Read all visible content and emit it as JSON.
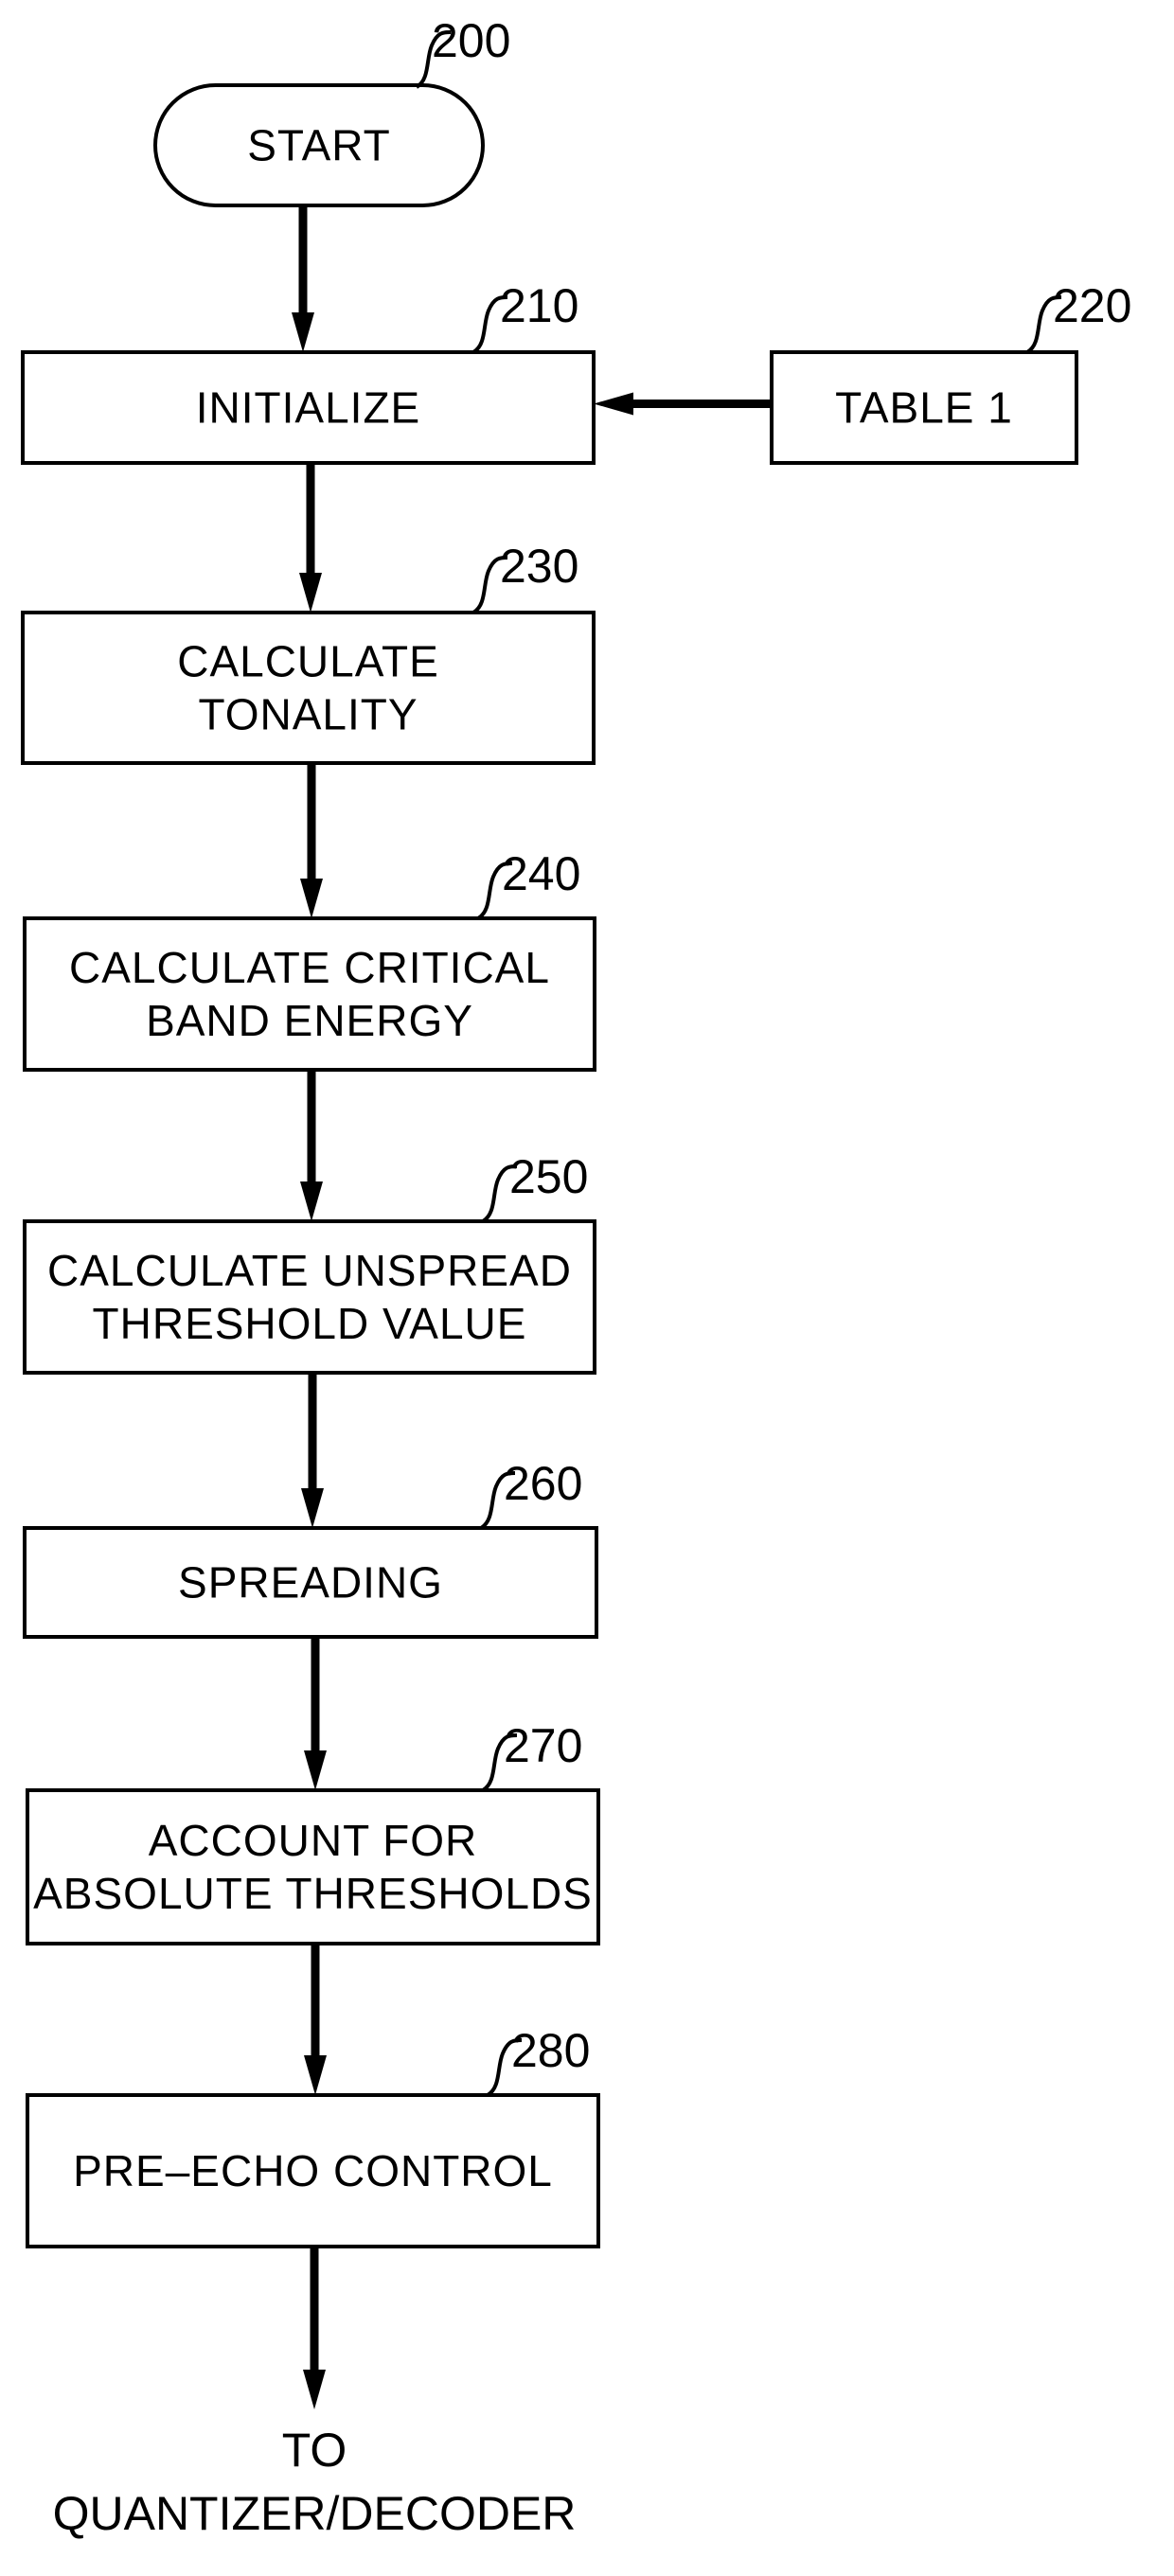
{
  "diagram": {
    "type": "flowchart",
    "nodes": [
      {
        "id": "200",
        "ref": "200",
        "shape": "terminator",
        "lines": [
          "START"
        ]
      },
      {
        "id": "210",
        "ref": "210",
        "shape": "process",
        "lines": [
          "INITIALIZE"
        ]
      },
      {
        "id": "220",
        "ref": "220",
        "shape": "process",
        "lines": [
          "TABLE  1"
        ]
      },
      {
        "id": "230",
        "ref": "230",
        "shape": "process",
        "lines": [
          "CALCULATE",
          "TONALITY"
        ]
      },
      {
        "id": "240",
        "ref": "240",
        "shape": "process",
        "lines": [
          "CALCULATE  CRITICAL",
          "BAND  ENERGY"
        ]
      },
      {
        "id": "250",
        "ref": "250",
        "shape": "process",
        "lines": [
          "CALCULATE  UNSPREAD",
          "THRESHOLD  VALUE"
        ]
      },
      {
        "id": "260",
        "ref": "260",
        "shape": "process",
        "lines": [
          "SPREADING"
        ]
      },
      {
        "id": "270",
        "ref": "270",
        "shape": "process",
        "lines": [
          "ACCOUNT  FOR",
          "ABSOLUTE  THRESHOLDS"
        ]
      },
      {
        "id": "280",
        "ref": "280",
        "shape": "process",
        "lines": [
          "PRE–ECHO  CONTROL"
        ]
      }
    ],
    "edges": [
      {
        "from": "200",
        "to": "210"
      },
      {
        "from": "220",
        "to": "210"
      },
      {
        "from": "210",
        "to": "230"
      },
      {
        "from": "230",
        "to": "240"
      },
      {
        "from": "240",
        "to": "250"
      },
      {
        "from": "250",
        "to": "260"
      },
      {
        "from": "260",
        "to": "270"
      },
      {
        "from": "270",
        "to": "280"
      },
      {
        "from": "280",
        "to": "output"
      }
    ],
    "output": {
      "lines": [
        "TO",
        "QUANTIZER/DECODER"
      ]
    }
  },
  "colors": {
    "ink": "#000000",
    "background": "#ffffff"
  }
}
